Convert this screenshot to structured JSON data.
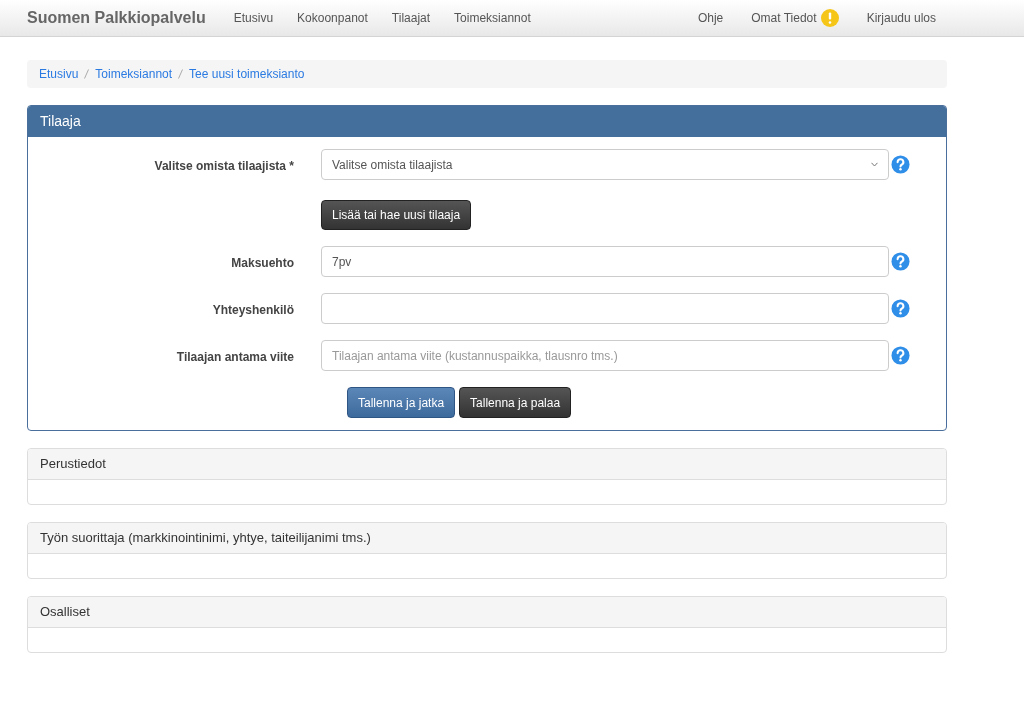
{
  "navbar": {
    "brand": "Suomen Palkkiopalvelu",
    "links": [
      {
        "label": "Etusivu"
      },
      {
        "label": "Kokoonpanot"
      },
      {
        "label": "Tilaajat"
      },
      {
        "label": "Toimeksiannot"
      }
    ],
    "right_links": [
      {
        "label": "Ohje",
        "alert": false
      },
      {
        "label": "Omat Tiedot",
        "alert": true
      },
      {
        "label": "Kirjaudu ulos",
        "alert": false
      }
    ]
  },
  "breadcrumb": [
    "Etusivu",
    "Toimeksiannot",
    "Tee uusi toimeksianto"
  ],
  "panel": {
    "title": "Tilaaja",
    "rows": [
      {
        "kind": "select",
        "label": "Valitse omista tilaajista *",
        "value": "Valitse omista tilaajista"
      },
      {
        "kind": "button",
        "label_button": "Lisää tai hae uusi tilaaja"
      },
      {
        "kind": "text",
        "label": "Maksuehto",
        "value": "7pv"
      },
      {
        "kind": "text",
        "label": "Yhteyshenkilö",
        "value": ""
      },
      {
        "kind": "text",
        "label": "Tilaajan antama viite",
        "placeholder": "Tilaajan antama viite (kustannuspaikka, tlausnro tms.)"
      }
    ],
    "buttons": [
      {
        "label": "Tallenna ja jatka",
        "primary": true
      },
      {
        "label": "Tallenna ja palaa",
        "primary": false
      }
    ]
  },
  "sections": [
    {
      "title": "Perustiedot"
    },
    {
      "title": "Työn suorittaja (markkinointinimi, yhtye, taiteilijanimi tms.)"
    },
    {
      "title": "Osalliset"
    }
  ]
}
